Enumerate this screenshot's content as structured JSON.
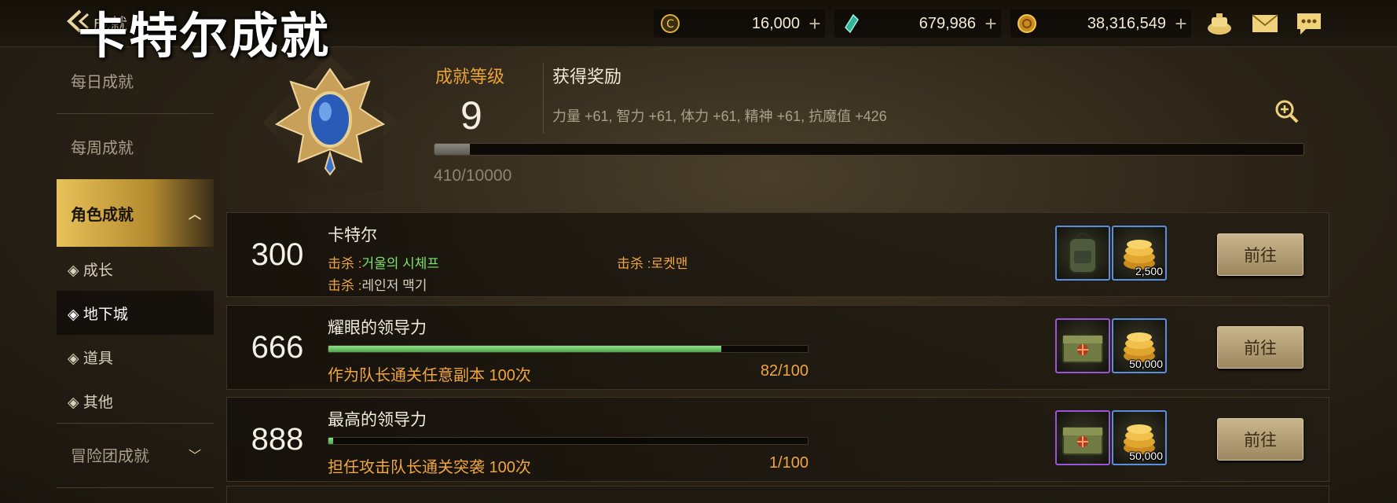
{
  "overlay_title": "卡特尔成就",
  "header": {
    "breadcrumb": "成就",
    "currencies": [
      {
        "name": "cera-point-icon",
        "value": "16,000"
      },
      {
        "name": "crystal-icon",
        "value": "679,986"
      },
      {
        "name": "gold-coin-icon",
        "value": "38,316,549"
      }
    ],
    "plus": "+"
  },
  "sidebar": {
    "daily": "每日成就",
    "weekly": "每周成就",
    "character": "角色成就",
    "subitems": [
      "◈ 成长",
      "◈ 地下城",
      "◈ 道具",
      "◈ 其他"
    ],
    "adventure": "冒险团成就"
  },
  "level_panel": {
    "level_label": "成就等级",
    "level": "9",
    "reward_label": "获得奖励",
    "reward_stats": "力量 +61, 智力 +61, 体力 +61, 精神 +61, 抗魔值 +426",
    "xp_text": "410/10000",
    "xp_current": 410,
    "xp_max": 10000
  },
  "achievements": [
    {
      "points": "300",
      "title": "卡特尔",
      "kills": [
        {
          "prefix": "击杀 :",
          "target": "거울의 시체프",
          "color": "green"
        },
        {
          "prefix": "击杀 :",
          "target": "로켓맨",
          "color": "yellow"
        },
        {
          "prefix": "击杀 :",
          "target": "레인저 맥기",
          "color": "white"
        }
      ],
      "rewards": [
        {
          "icon": "backpack-icon",
          "qty": ""
        },
        {
          "icon": "gold-coins-icon",
          "qty": "2,500"
        }
      ],
      "button": "前往"
    },
    {
      "points": "666",
      "title": "耀眼的领导力",
      "progress_desc": "作为队长通关任意副本 100次",
      "progress_text": "82/100",
      "progress": 0.82,
      "rewards": [
        {
          "icon": "treasure-chest-icon",
          "qty": ""
        },
        {
          "icon": "gold-coins-icon",
          "qty": "50,000"
        }
      ],
      "button": "前往"
    },
    {
      "points": "888",
      "title": "最高的领导力",
      "progress_desc": "担任攻击队长通关突袭 100次",
      "progress_text": "1/100",
      "progress": 0.01,
      "rewards": [
        {
          "icon": "treasure-chest-icon",
          "qty": ""
        },
        {
          "icon": "gold-coins-icon",
          "qty": "50,000"
        }
      ],
      "button": "前往"
    }
  ],
  "colors": {
    "accent_gold": "#e9a33b",
    "kill_green": "#7fe36b",
    "progress_green": "#6cc066"
  }
}
